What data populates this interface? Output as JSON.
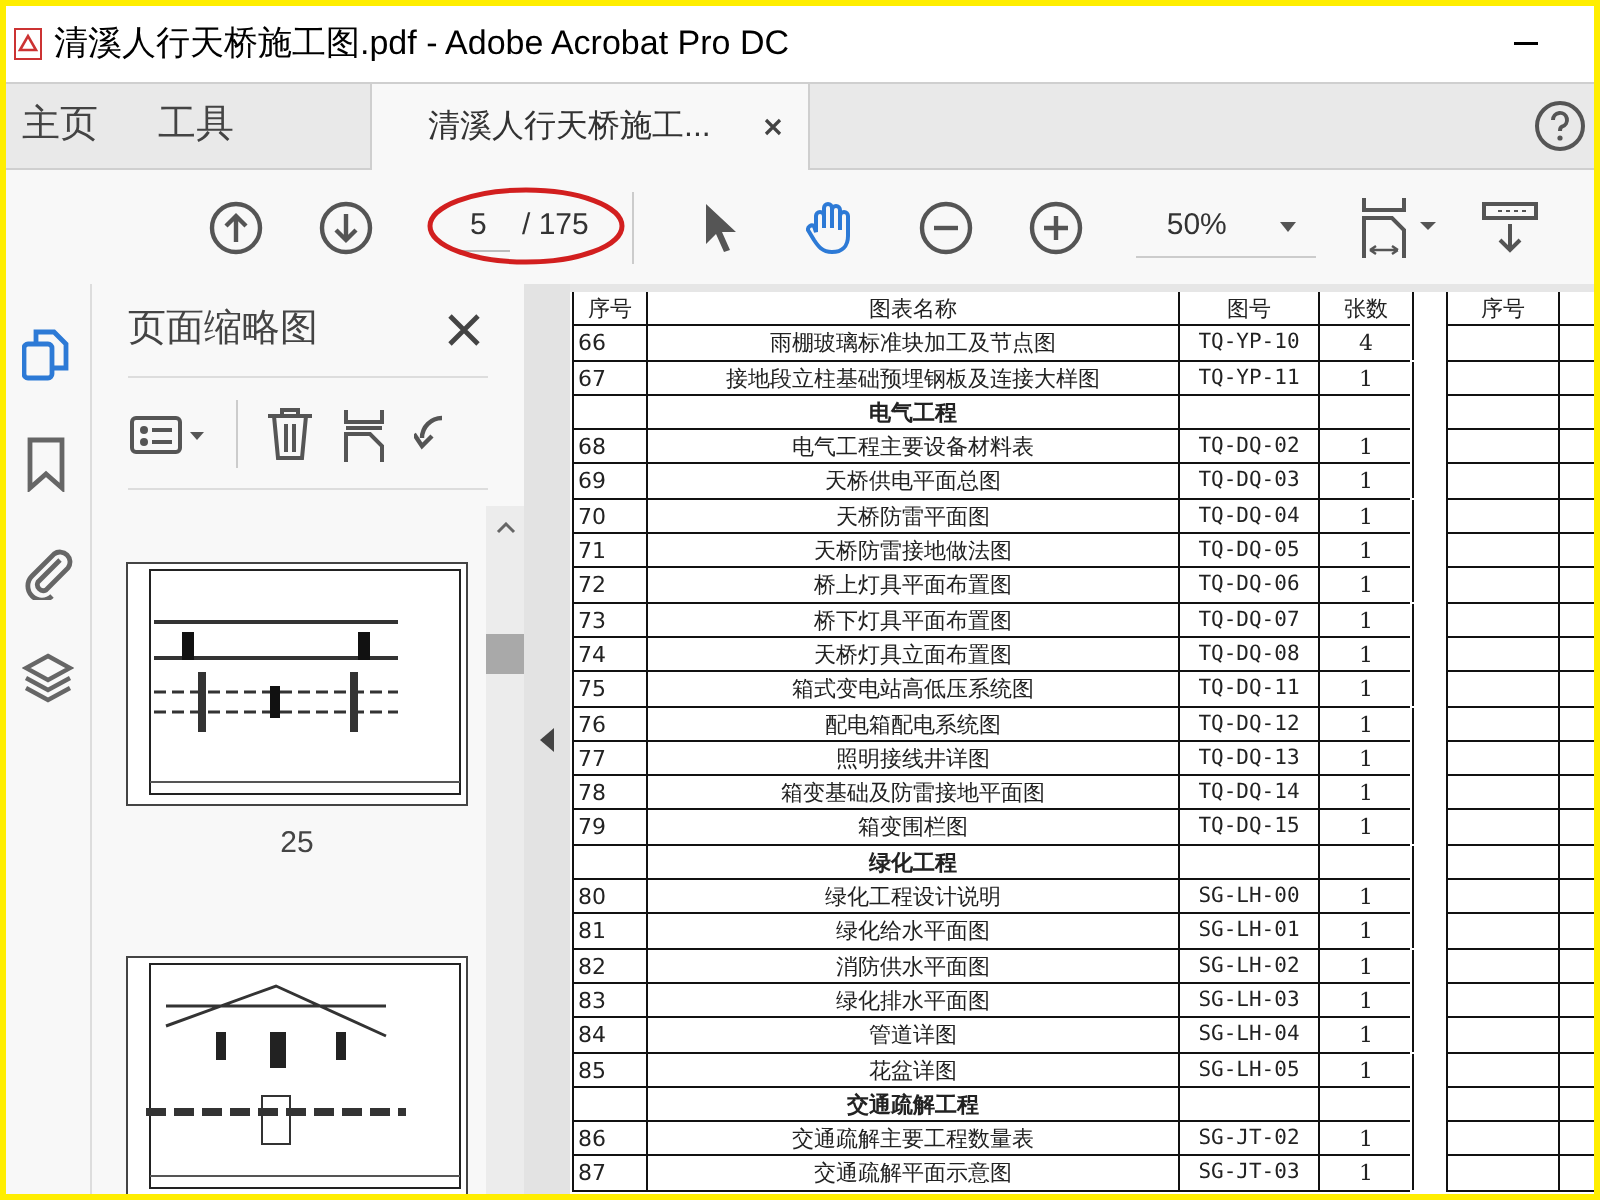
{
  "window": {
    "title": "清溪人行天桥施工图.pdf - Adobe Acrobat Pro DC"
  },
  "nav_tabs": [
    {
      "label": "主页",
      "selected": false
    },
    {
      "label": "工具",
      "selected": false
    },
    {
      "label": "清溪人行天桥施工...",
      "selected": true
    }
  ],
  "toolbar": {
    "page": "5",
    "page_total": "/ 175",
    "zoom": "50%"
  },
  "sidebar_tools": [
    {
      "kind": "pages",
      "selected": true
    },
    {
      "kind": "bookmarks",
      "selected": false
    },
    {
      "kind": "attachments",
      "selected": false
    },
    {
      "kind": "layers",
      "selected": false
    }
  ],
  "thumbnails_panel": {
    "title": "页面缩略图",
    "pages": [
      {
        "kind": "picture",
        "label": "25"
      },
      {
        "kind": "picture"
      }
    ]
  },
  "table": {
    "columns": [
      "序号",
      "图表名称",
      "图号",
      "张数"
    ],
    "side_columns": [
      "序号"
    ],
    "rows": [
      {
        "kind": "item",
        "no": "66",
        "name": "雨棚玻璃标准块加工及节点图",
        "code": "TQ-YP-10",
        "count": "4"
      },
      {
        "kind": "item",
        "no": "67",
        "name": "接地段立柱基础预埋钢板及连接大样图",
        "code": "TQ-YP-11",
        "count": "1"
      },
      {
        "kind": "section",
        "name": "电气工程"
      },
      {
        "kind": "item",
        "no": "68",
        "name": "电气工程主要设备材料表",
        "code": "TQ-DQ-02",
        "count": "1"
      },
      {
        "kind": "item",
        "no": "69",
        "name": "天桥供电平面总图",
        "code": "TQ-DQ-03",
        "count": "1"
      },
      {
        "kind": "item",
        "no": "70",
        "name": "天桥防雷平面图",
        "code": "TQ-DQ-04",
        "count": "1"
      },
      {
        "kind": "item",
        "no": "71",
        "name": "天桥防雷接地做法图",
        "code": "TQ-DQ-05",
        "count": "1"
      },
      {
        "kind": "item",
        "no": "72",
        "name": "桥上灯具平面布置图",
        "code": "TQ-DQ-06",
        "count": "1"
      },
      {
        "kind": "item",
        "no": "73",
        "name": "桥下灯具平面布置图",
        "code": "TQ-DQ-07",
        "count": "1"
      },
      {
        "kind": "item",
        "no": "74",
        "name": "天桥灯具立面布置图",
        "code": "TQ-DQ-08",
        "count": "1"
      },
      {
        "kind": "item",
        "no": "75",
        "name": "箱式变电站高低压系统图",
        "code": "TQ-DQ-11",
        "count": "1"
      },
      {
        "kind": "item",
        "no": "76",
        "name": "配电箱配电系统图",
        "code": "TQ-DQ-12",
        "count": "1"
      },
      {
        "kind": "item",
        "no": "77",
        "name": "照明接线井详图",
        "code": "TQ-DQ-13",
        "count": "1"
      },
      {
        "kind": "item",
        "no": "78",
        "name": "箱变基础及防雷接地平面图",
        "code": "TQ-DQ-14",
        "count": "1"
      },
      {
        "kind": "item",
        "no": "79",
        "name": "箱变围栏图",
        "code": "TQ-DQ-15",
        "count": "1"
      },
      {
        "kind": "section",
        "name": "绿化工程"
      },
      {
        "kind": "item",
        "no": "80",
        "name": "绿化工程设计说明",
        "code": "SG-LH-00",
        "count": "1"
      },
      {
        "kind": "item",
        "no": "81",
        "name": "绿化给水平面图",
        "code": "SG-LH-01",
        "count": "1"
      },
      {
        "kind": "item",
        "no": "82",
        "name": "消防供水平面图",
        "code": "SG-LH-02",
        "count": "1"
      },
      {
        "kind": "item",
        "no": "83",
        "name": "绿化排水平面图",
        "code": "SG-LH-03",
        "count": "1"
      },
      {
        "kind": "item",
        "no": "84",
        "name": "管道详图",
        "code": "SG-LH-04",
        "count": "1"
      },
      {
        "kind": "item",
        "no": "85",
        "name": "花盆详图",
        "code": "SG-LH-05",
        "count": "1"
      },
      {
        "kind": "section",
        "name": "交通疏解工程"
      },
      {
        "kind": "item",
        "no": "86",
        "name": "交通疏解主要工程数量表",
        "code": "SG-JT-02",
        "count": "1"
      },
      {
        "kind": "item",
        "no": "87",
        "name": "交通疏解平面示意图",
        "code": "SG-JT-03",
        "count": "1"
      }
    ]
  }
}
